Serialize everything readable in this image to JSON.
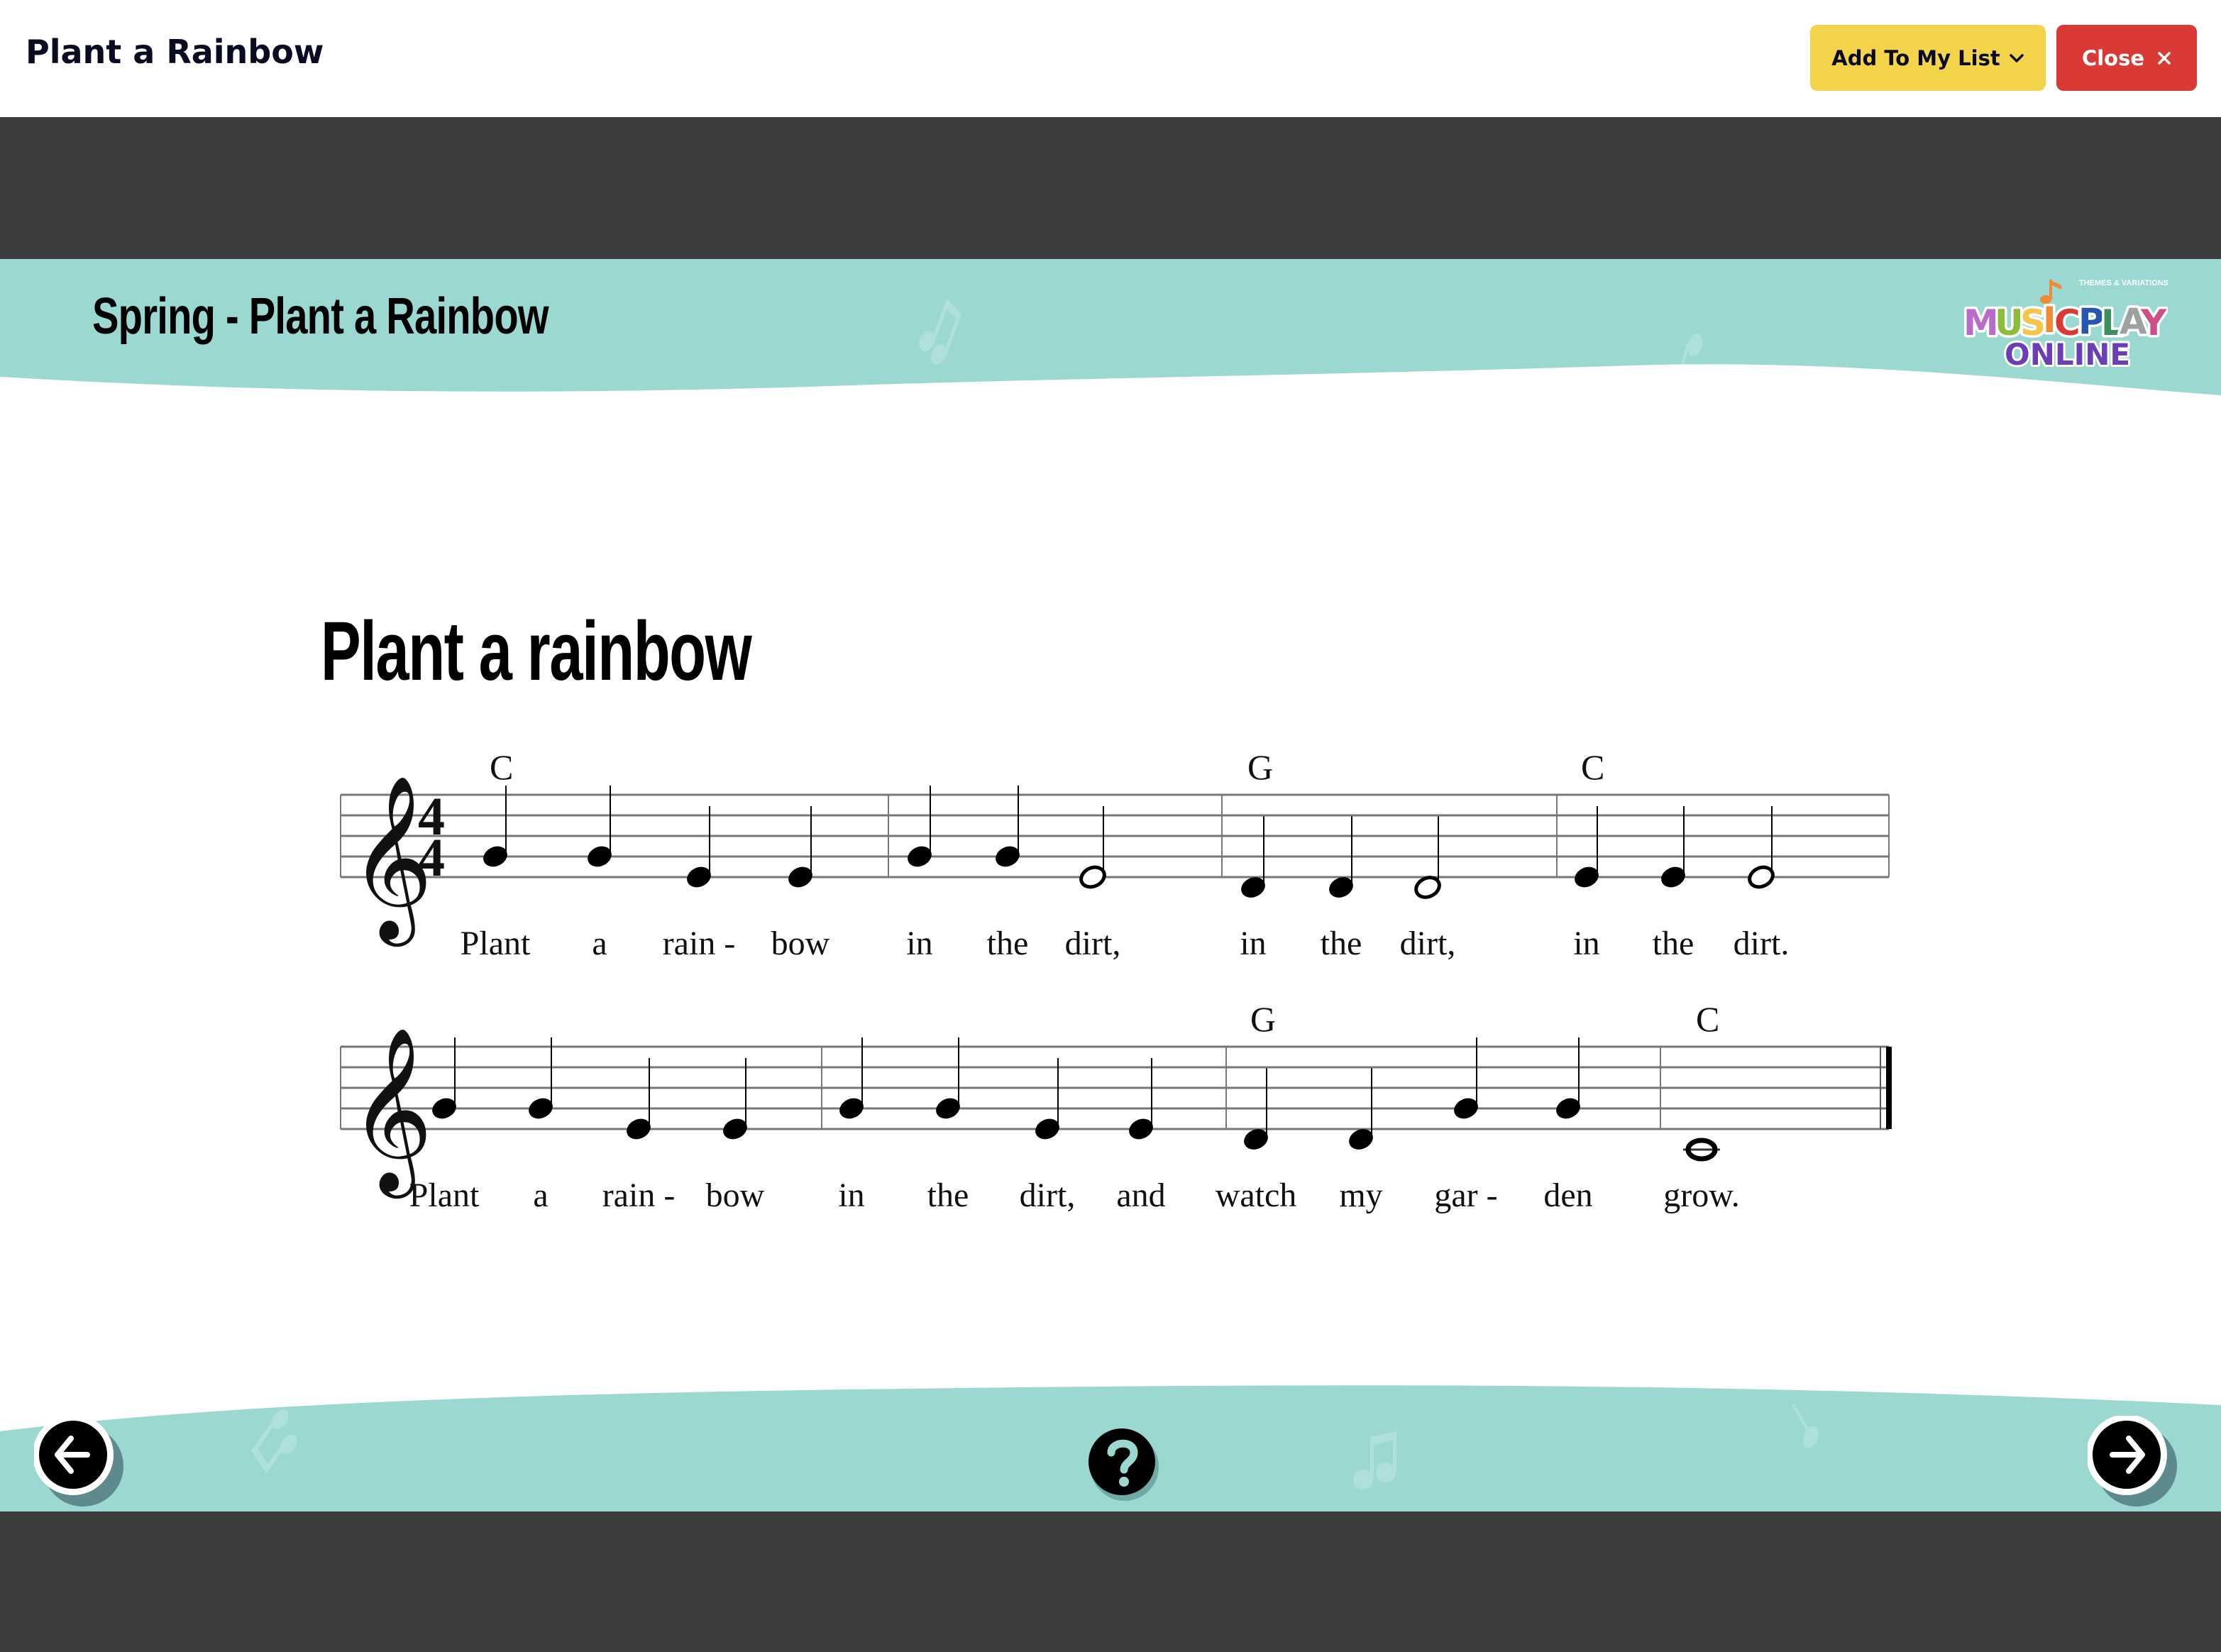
{
  "topbar": {
    "title": "Plant a Rainbow",
    "add_to_list_label": "Add To My List",
    "add_to_list_icon": "chevron-down-icon",
    "close_label": "Close",
    "close_icon": "close-icon"
  },
  "slide": {
    "header_title": "Spring - Plant a Rainbow",
    "logo": {
      "tagline": "THEMES & VARIATIONS",
      "word1": "MUSICPLAY",
      "word2": "ONLINE"
    },
    "song_title": "Plant a rainbow"
  },
  "score": {
    "clef": "treble",
    "time_signature": "4/4",
    "systems": [
      {
        "chords": [
          {
            "label": "C",
            "measure": 1
          },
          {
            "label": "G",
            "measure": 3
          },
          {
            "label": "C",
            "measure": 4
          }
        ],
        "measures": [
          [
            {
              "pitch": "G4",
              "dur": "q",
              "lyric": "Plant"
            },
            {
              "pitch": "G4",
              "dur": "q",
              "lyric": "a"
            },
            {
              "pitch": "E4",
              "dur": "q",
              "lyric": "rain -"
            },
            {
              "pitch": "E4",
              "dur": "q",
              "lyric": "bow"
            }
          ],
          [
            {
              "pitch": "G4",
              "dur": "q",
              "lyric": "in"
            },
            {
              "pitch": "G4",
              "dur": "q",
              "lyric": "the"
            },
            {
              "pitch": "E4",
              "dur": "h",
              "lyric": "dirt,"
            }
          ],
          [
            {
              "pitch": "D4",
              "dur": "q",
              "lyric": "in"
            },
            {
              "pitch": "D4",
              "dur": "q",
              "lyric": "the"
            },
            {
              "pitch": "D4",
              "dur": "h",
              "lyric": "dirt,"
            }
          ],
          [
            {
              "pitch": "E4",
              "dur": "q",
              "lyric": "in"
            },
            {
              "pitch": "E4",
              "dur": "q",
              "lyric": "the"
            },
            {
              "pitch": "E4",
              "dur": "h",
              "lyric": "dirt."
            }
          ]
        ]
      },
      {
        "chords": [
          {
            "label": "G",
            "measure": 3
          },
          {
            "label": "C",
            "measure": 4
          }
        ],
        "measures": [
          [
            {
              "pitch": "G4",
              "dur": "q",
              "lyric": "Plant"
            },
            {
              "pitch": "G4",
              "dur": "q",
              "lyric": "a"
            },
            {
              "pitch": "E4",
              "dur": "q",
              "lyric": "rain -"
            },
            {
              "pitch": "E4",
              "dur": "q",
              "lyric": "bow"
            }
          ],
          [
            {
              "pitch": "G4",
              "dur": "q",
              "lyric": "in"
            },
            {
              "pitch": "G4",
              "dur": "q",
              "lyric": "the"
            },
            {
              "pitch": "E4",
              "dur": "q",
              "lyric": "dirt,"
            },
            {
              "pitch": "E4",
              "dur": "q",
              "lyric": "and"
            }
          ],
          [
            {
              "pitch": "D4",
              "dur": "q",
              "lyric": "watch"
            },
            {
              "pitch": "D4",
              "dur": "q",
              "lyric": "my"
            },
            {
              "pitch": "G4",
              "dur": "q",
              "lyric": "gar -"
            },
            {
              "pitch": "G4",
              "dur": "q",
              "lyric": "den"
            }
          ],
          [
            {
              "pitch": "C4",
              "dur": "w",
              "lyric": "grow."
            }
          ]
        ]
      }
    ]
  },
  "footer": {
    "prev_icon": "arrow-left-icon",
    "help_icon": "help-icon",
    "next_icon": "arrow-right-icon"
  },
  "colors": {
    "teal": "#9AD8D1",
    "dark_band": "#3D3D3D",
    "add_button": "#F4D44A",
    "close_button": "#D93A35",
    "title_text": "#0A0A23"
  }
}
